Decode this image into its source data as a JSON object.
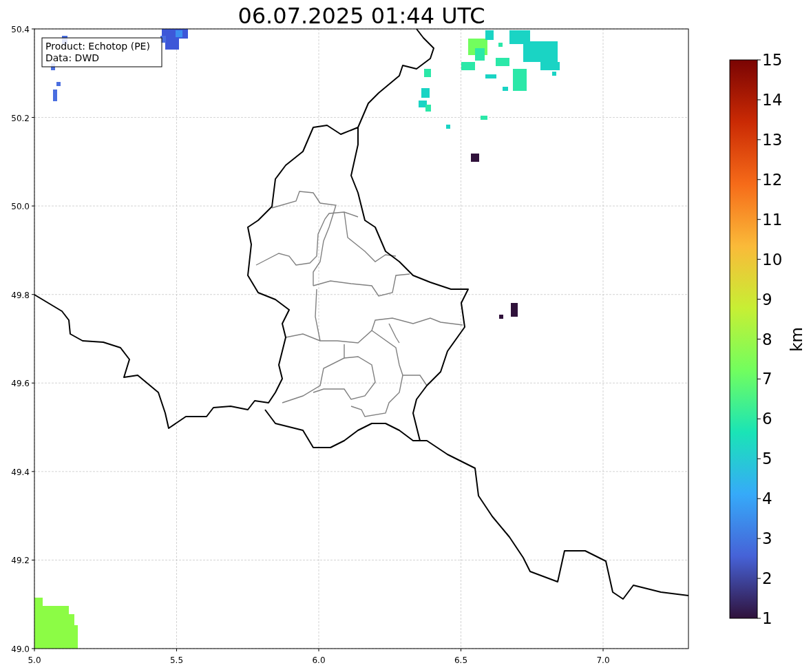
{
  "title": "06.07.2025 01:44 UTC",
  "legend": [
    "Product: Echotop (PE)",
    "Data: DWD"
  ],
  "x_ticks": [
    "5.0",
    "5.5",
    "6.0",
    "6.5",
    "7.0"
  ],
  "y_ticks": [
    "50.4",
    "50.2",
    "50.0",
    "49.8",
    "49.6",
    "49.4",
    "49.2",
    "49.0"
  ],
  "colorbar": {
    "label": "km",
    "ticks": [
      "15",
      "14",
      "13",
      "12",
      "11",
      "10",
      "9",
      "8",
      "7",
      "6",
      "5",
      "4",
      "3",
      "2",
      "1"
    ]
  }
}
